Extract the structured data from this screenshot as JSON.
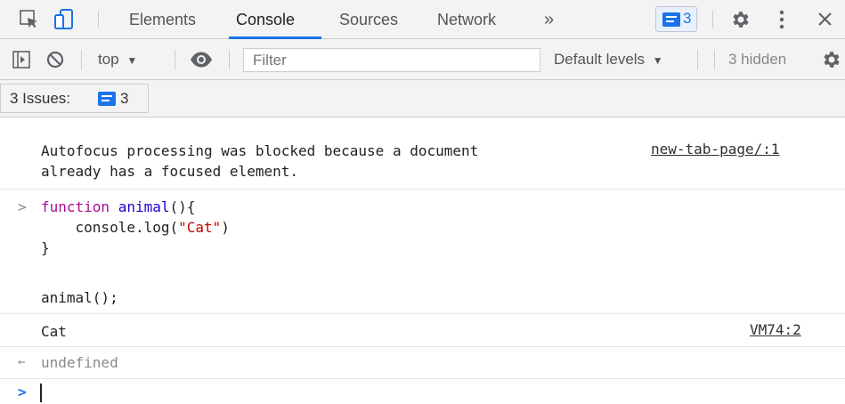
{
  "tabs": [
    "Elements",
    "Console",
    "Sources",
    "Network"
  ],
  "tabs_overflow": "»",
  "issue_badge_count": "3",
  "toolbar": {
    "context": "top",
    "filter_placeholder": "Filter",
    "levels": "Default levels",
    "hidden": "3 hidden"
  },
  "issues": {
    "label": "3 Issues:",
    "count": "3"
  },
  "console": {
    "warning_line1": "Autofocus processing was blocked because a document",
    "warning_line2": "already has a focused element.",
    "warning_source": "new-tab-page/:1",
    "input": {
      "l1_kw": "function",
      "l1_fn": "animal",
      "l1_rest": "(){",
      "l2_pre": "    console.log(",
      "l2_str": "\"Cat\"",
      "l2_post": ")",
      "l3": "}",
      "l5": "animal();"
    },
    "log_output": "Cat",
    "log_source": "VM74:2",
    "return_value": "undefined",
    "prompt_arrow": ">",
    "result_arrow": "←"
  },
  "colors": {
    "accent": "#1a73e8",
    "keyword": "#aa0d91",
    "string": "#c80000",
    "function": "#1c00cf"
  }
}
